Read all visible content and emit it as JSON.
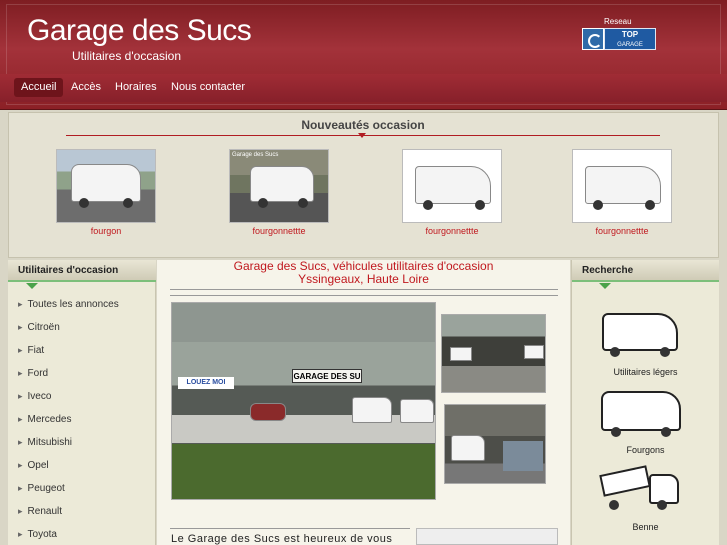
{
  "header": {
    "title": "Garage des Sucs",
    "subtitle": "Utilitaires d'occasion",
    "network_label": "Reseau",
    "network_logo_top": "TOP",
    "network_logo_bottom": "GARAGE"
  },
  "nav": {
    "items": [
      {
        "label": "Accueil",
        "active": true
      },
      {
        "label": "Accès"
      },
      {
        "label": "Horaires"
      },
      {
        "label": "Nous contacter"
      }
    ]
  },
  "news": {
    "title": "Nouveautés occasion",
    "items": [
      {
        "label": "fourgon"
      },
      {
        "label": "fourgonnettte",
        "caption": "Garage des Sucs"
      },
      {
        "label": "fourgonnettte"
      },
      {
        "label": "fourgonnettte"
      }
    ]
  },
  "left": {
    "title": "Utilitaires d'occasion",
    "brands": [
      "Toutes les annonces",
      "Citroën",
      "Fiat",
      "Ford",
      "Iveco",
      "Mercedes",
      "Mitsubishi",
      "Opel",
      "Peugeot",
      "Renault",
      "Toyota"
    ]
  },
  "main": {
    "title_line1": "Garage des Sucs, véhicules utilitaires d'occasion",
    "title_line2": "Yssingeaux, Haute Loire",
    "sign_text": "GARAGE DES SU",
    "banner_text": "LOUEZ MOI",
    "intro_text": "Le Garage des Sucs est heureux de vous"
  },
  "right": {
    "title": "Recherche",
    "categories": [
      "Utilitaires légers",
      "Fourgons",
      "Benne"
    ]
  },
  "colors": {
    "header_red": "#a3323a",
    "link_red": "#c0181e",
    "accent_green": "#4aa24a"
  }
}
